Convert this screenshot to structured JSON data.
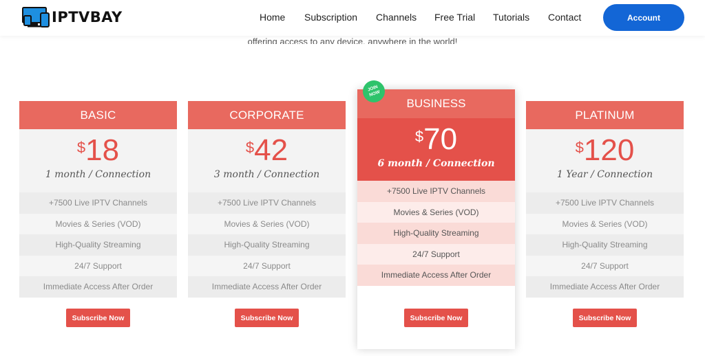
{
  "brand": {
    "name": "IPTVBAY"
  },
  "nav": {
    "items": [
      "Home",
      "Subscription",
      "Channels",
      "Free Trial",
      "Tutorials",
      "Contact"
    ],
    "account_label": "Account"
  },
  "subline": "offering access to any device, anywhere in the world!",
  "plans": [
    {
      "name": "BASIC",
      "currency": "$",
      "price": "18",
      "period": "1 month / Connection",
      "features": [
        "+7500 Live IPTV Channels",
        "Movies & Series (VOD)",
        "High-Quality Streaming",
        "24/7 Support",
        "Immediate Access After Order"
      ],
      "button": "Subscribe Now"
    },
    {
      "name": "CORPORATE",
      "currency": "$",
      "price": "42",
      "period": "3 month / Connection",
      "features": [
        "+7500 Live IPTV Channels",
        "Movies & Series (VOD)",
        "High-Quality Streaming",
        "24/7 Support",
        "Immediate Access After Order"
      ],
      "button": "Subscribe Now"
    },
    {
      "name": "BUSINESS",
      "currency": "$",
      "price": "70",
      "period": "6 month / Connection",
      "badge": "JOIN NOW",
      "features": [
        "+7500 Live IPTV Channels",
        "Movies & Series (VOD)",
        "High-Quality Streaming",
        "24/7 Support",
        "Immediate Access After Order"
      ],
      "button": "Subscribe Now"
    },
    {
      "name": "PLATINUM",
      "currency": "$",
      "price": "120",
      "period": "1 Year / Connection",
      "features": [
        "+7500 Live IPTV Channels",
        "Movies & Series (VOD)",
        "High-Quality Streaming",
        "24/7 Support",
        "Immediate Access After Order"
      ],
      "button": "Subscribe Now"
    }
  ],
  "colors": {
    "accent": "#e4514a",
    "header": "#e8695f",
    "primary": "#1366d6",
    "badge": "#2ec36b"
  }
}
